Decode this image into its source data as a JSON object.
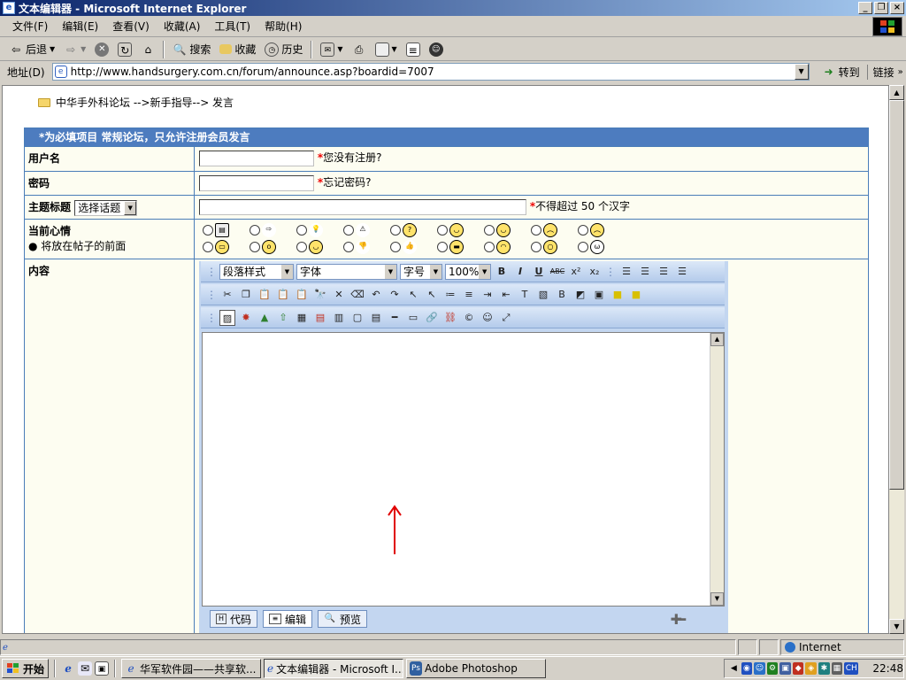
{
  "window": {
    "title": "文本编辑器 - Microsoft Internet Explorer"
  },
  "menu": [
    "文件(F)",
    "编辑(E)",
    "查看(V)",
    "收藏(A)",
    "工具(T)",
    "帮助(H)"
  ],
  "toolbar": {
    "back": "后退",
    "search": "搜索",
    "favorites": "收藏",
    "history": "历史"
  },
  "address": {
    "label": "地址(D)",
    "url": "http://www.handsurgery.com.cn/forum/announce.asp?boardid=7007",
    "go": "转到",
    "links": "链接"
  },
  "breadcrumb": "中华手外科论坛 -->新手指导--> 发言",
  "form": {
    "header": "*为必填项目 常规论坛，只允许注册会员发言",
    "username_label": "用户名",
    "username_hint": "您没有注册?",
    "password_label": "密码",
    "password_hint": "忘记密码?",
    "subject_label": "主题标题",
    "topic_select": "选择话题",
    "subject_hint": "不得超过 50 个汉字",
    "mood_label": "当前心情",
    "mood_note": "将放在帖子的前面",
    "content_label": "内容"
  },
  "editor": {
    "style_select": "段落样式",
    "font_select": "字体",
    "size_select": "字号",
    "zoom_select": "100%",
    "tabs": [
      "代码",
      "编辑",
      "预览"
    ],
    "active_tab": "编辑"
  },
  "status": {
    "zone": "Internet"
  },
  "taskbar": {
    "start": "开始",
    "tasks": [
      "华军软件园——共享软...",
      "文本编辑器 - Microsoft I...",
      "Adobe Photoshop"
    ],
    "clock": "22:48",
    "lang": "CH"
  },
  "colors": {
    "header_blue": "#4d7cbf",
    "annotation_arrow": "#e00000"
  }
}
